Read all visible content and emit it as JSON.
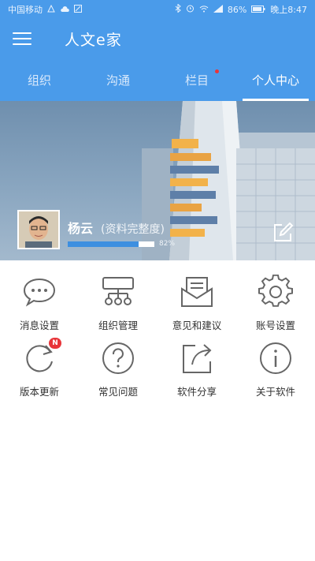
{
  "status_bar": {
    "carrier": "中国移动",
    "battery": "86%",
    "time": "晚上8:47"
  },
  "app_bar": {
    "title": "人文e家",
    "menu_icon": "hamburger-menu-icon"
  },
  "tabs": [
    {
      "label": "组织",
      "active": false,
      "dot": false
    },
    {
      "label": "沟通",
      "active": false,
      "dot": false
    },
    {
      "label": "栏目",
      "active": false,
      "dot": true
    },
    {
      "label": "个人中心",
      "active": true,
      "dot": false
    }
  ],
  "profile": {
    "name": "杨云",
    "completeness_label": "(资料完整度)",
    "completeness_value": 0.82,
    "completeness_text": "82%",
    "edit_icon": "edit-icon"
  },
  "menu_grid": [
    {
      "label": "消息设置",
      "icon": "chat-bubble-icon"
    },
    {
      "label": "组织管理",
      "icon": "org-chart-icon"
    },
    {
      "label": "意见和建议",
      "icon": "mail-icon"
    },
    {
      "label": "账号设置",
      "icon": "gear-icon"
    },
    {
      "label": "版本更新",
      "icon": "refresh-icon",
      "badge": "N"
    },
    {
      "label": "常见问题",
      "icon": "question-icon"
    },
    {
      "label": "软件分享",
      "icon": "share-icon"
    },
    {
      "label": "关于软件",
      "icon": "info-icon"
    }
  ],
  "colors": {
    "primary": "#4a9bea",
    "progress": "#3d8fe0",
    "badge": "#e8353a",
    "icon_stroke": "#666666"
  }
}
